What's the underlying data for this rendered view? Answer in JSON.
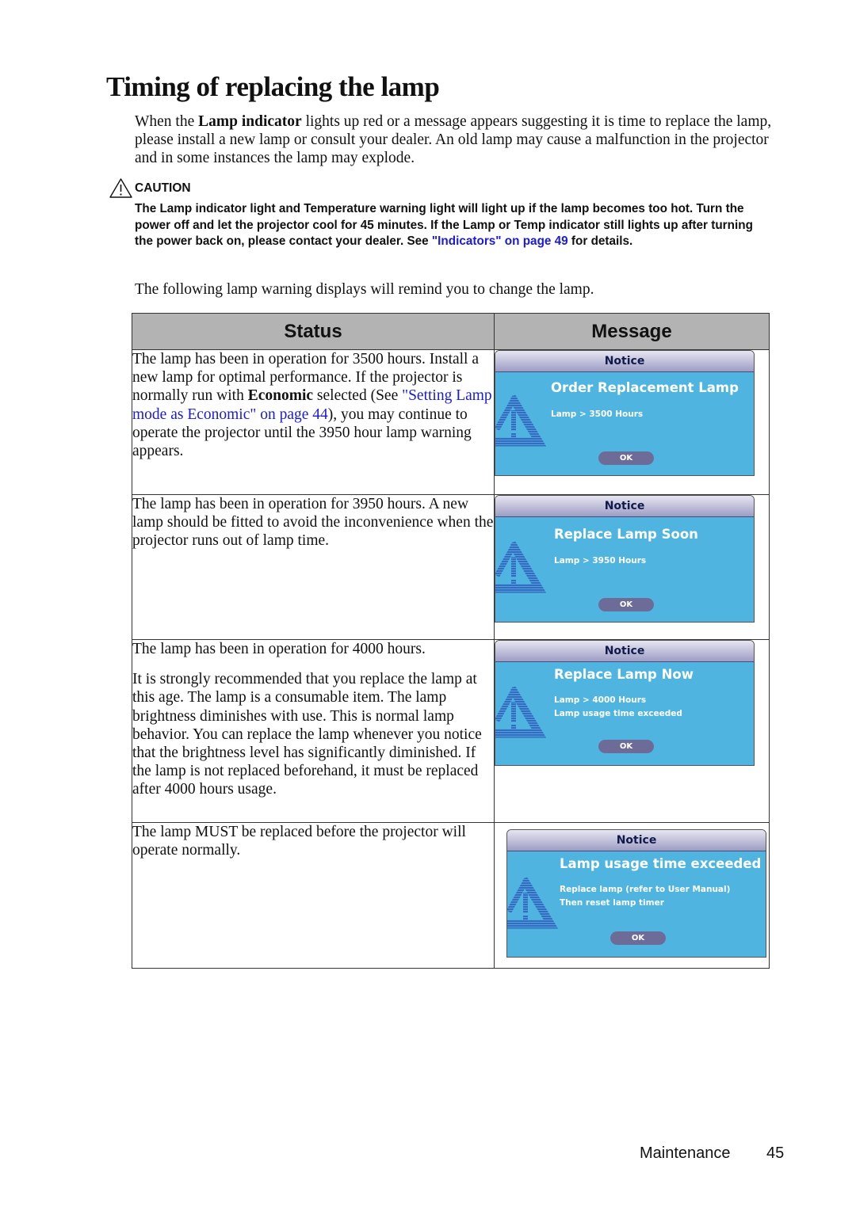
{
  "title": "Timing of replacing the lamp",
  "intro": {
    "prefix": "When the ",
    "bold": "Lamp indicator",
    "suffix": " lights up red or a message appears suggesting it is time to replace the lamp, please install a new lamp or consult your dealer. An old lamp may cause a malfunction in the projector and in some instances the lamp may explode."
  },
  "caution": {
    "icon": "warning-triangle-icon",
    "label": "CAUTION",
    "text": "The Lamp indicator light and Temperature warning light will light up if the lamp becomes too hot. Turn the power off and let the projector cool for 45 minutes. If the Lamp or Temp indicator still lights up after turning the power back on, please contact your dealer. See ",
    "link": "\"Indicators\" on page 49",
    "suffix": " for details."
  },
  "following_text": "The following lamp warning displays will remind you to change the lamp.",
  "table": {
    "headers": [
      "Status",
      "Message"
    ],
    "rows": [
      {
        "status_a": "The lamp has been in operation for 3500 hours. Install a new lamp for optimal performance. If the projector is normally run with ",
        "status_bold": "Economic",
        "status_b": " selected (See ",
        "status_link": "\"Setting Lamp mode as Economic\" on page 44",
        "status_c": "), you may continue to operate the projector until the 3950 hour lamp warning appears.",
        "notice": {
          "header": "Notice",
          "title": "Order Replacement Lamp",
          "lines": [
            "Lamp > 3500 Hours"
          ],
          "ok": "OK"
        }
      },
      {
        "status_a": "The lamp has been in operation for 3950 hours. A new lamp should be fitted to avoid the inconvenience when the projector runs out of lamp time.",
        "notice": {
          "header": "Notice",
          "title": "Replace Lamp Soon",
          "lines": [
            "Lamp > 3950 Hours"
          ],
          "ok": "OK"
        }
      },
      {
        "status_a": "The lamp has been in operation for 4000 hours.",
        "status_p2": "It is strongly recommended that you replace the lamp at this age. The lamp is a consumable item. The lamp brightness diminishes with use. This is normal lamp behavior. You can replace the lamp whenever you notice that the brightness level has significantly diminished. If the lamp is not replaced beforehand, it must be replaced after 4000 hours usage.",
        "notice": {
          "header": "Notice",
          "title": "Replace Lamp Now",
          "lines": [
            "Lamp > 4000 Hours",
            "Lamp usage time exceeded"
          ],
          "ok": "OK"
        }
      },
      {
        "status_a": "The lamp MUST be replaced before the projector will operate normally.",
        "notice": {
          "header": "Notice",
          "title": "Lamp usage time exceeded",
          "lines": [
            "Replace lamp (refer to User Manual)",
            "Then reset lamp timer"
          ],
          "ok": "OK"
        }
      }
    ]
  },
  "footer": {
    "section": "Maintenance",
    "page": "45"
  },
  "colors": {
    "link": "#1a1adb",
    "notice_body": "#4fb5e0",
    "ok_button": "#6d6c98",
    "table_header": "#b3b3b3"
  }
}
